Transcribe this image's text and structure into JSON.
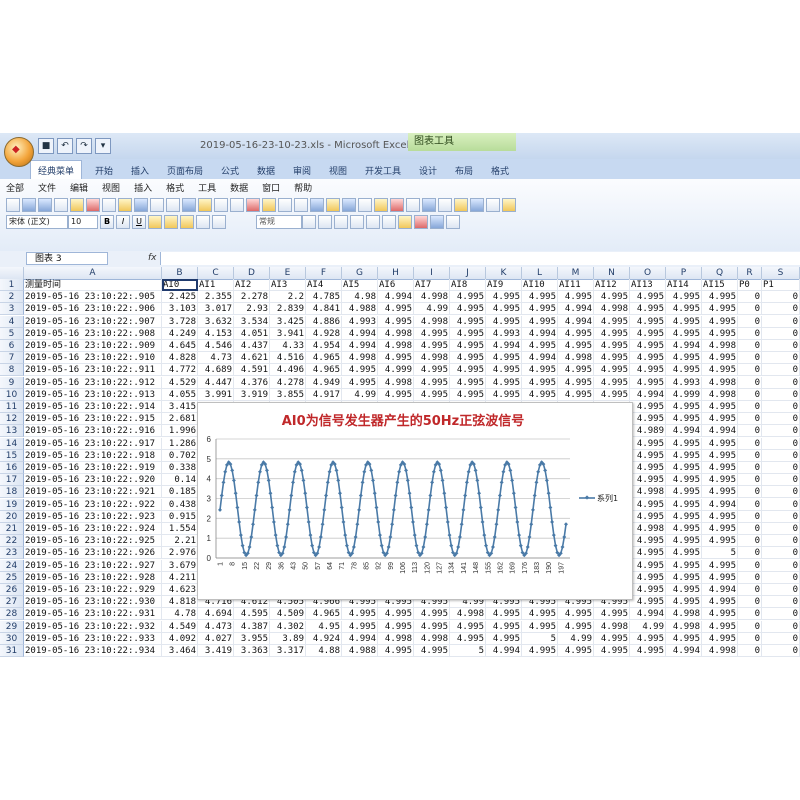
{
  "window": {
    "title": "2019-05-16-23-10-23.xls - Microsoft Excel",
    "context_tab": "图表工具"
  },
  "ribbon_tabs": [
    "经典菜单",
    "开始",
    "插入",
    "页面布局",
    "公式",
    "数据",
    "审阅",
    "视图",
    "开发工具",
    "设计",
    "布局",
    "格式"
  ],
  "menu": [
    "全部",
    "文件",
    "编辑",
    "视图",
    "插入",
    "格式",
    "工具",
    "数据",
    "窗口",
    "帮助"
  ],
  "toolbar": {
    "font": "宋体 (正文)",
    "size": "10",
    "number_format": "常规",
    "bold": "B",
    "italic": "I",
    "underline": "U"
  },
  "formula_bar": {
    "name_box": "图表 3",
    "fx": "fx",
    "content": ""
  },
  "columns": [
    "A",
    "B",
    "C",
    "D",
    "E",
    "F",
    "G",
    "H",
    "I",
    "J",
    "K",
    "L",
    "M",
    "N",
    "O",
    "P",
    "Q",
    "R",
    "S"
  ],
  "header_row": [
    "测量时间",
    "AI0",
    "AI1",
    "AI2",
    "AI3",
    "AI4",
    "AI5",
    "AI6",
    "AI7",
    "AI8",
    "AI9",
    "AI10",
    "AI11",
    "AI12",
    "AI13",
    "AI14",
    "AI15",
    "P0",
    "P1"
  ],
  "rows": [
    [
      "2019-05-16 23:10:22:.905",
      "2.425",
      "2.355",
      "2.278",
      "2.2",
      "4.785",
      "4.98",
      "4.994",
      "4.998",
      "4.995",
      "4.995",
      "4.995",
      "4.995",
      "4.995",
      "4.995",
      "4.995",
      "4.995",
      "0",
      "0"
    ],
    [
      "2019-05-16 23:10:22:.906",
      "3.103",
      "3.017",
      "2.93",
      "2.839",
      "4.841",
      "4.988",
      "4.995",
      "4.99",
      "4.995",
      "4.995",
      "4.995",
      "4.994",
      "4.998",
      "4.995",
      "4.995",
      "4.995",
      "0",
      "0"
    ],
    [
      "2019-05-16 23:10:22:.907",
      "3.728",
      "3.632",
      "3.534",
      "3.425",
      "4.886",
      "4.993",
      "4.995",
      "4.998",
      "4.995",
      "4.995",
      "4.995",
      "4.994",
      "4.995",
      "4.995",
      "4.995",
      "4.995",
      "0",
      "0"
    ],
    [
      "2019-05-16 23:10:22:.908",
      "4.249",
      "4.153",
      "4.051",
      "3.941",
      "4.928",
      "4.994",
      "4.998",
      "4.995",
      "4.995",
      "4.993",
      "4.994",
      "4.995",
      "4.995",
      "4.995",
      "4.995",
      "4.995",
      "0",
      "0"
    ],
    [
      "2019-05-16 23:10:22:.909",
      "4.645",
      "4.546",
      "4.437",
      "4.33",
      "4.954",
      "4.994",
      "4.998",
      "4.995",
      "4.995",
      "4.994",
      "4.995",
      "4.995",
      "4.995",
      "4.995",
      "4.994",
      "4.998",
      "0",
      "0"
    ],
    [
      "2019-05-16 23:10:22:.910",
      "4.828",
      "4.73",
      "4.621",
      "4.516",
      "4.965",
      "4.998",
      "4.995",
      "4.998",
      "4.995",
      "4.995",
      "4.994",
      "4.998",
      "4.995",
      "4.995",
      "4.995",
      "4.995",
      "0",
      "0"
    ],
    [
      "2019-05-16 23:10:22:.911",
      "4.772",
      "4.689",
      "4.591",
      "4.496",
      "4.965",
      "4.995",
      "4.999",
      "4.995",
      "4.995",
      "4.995",
      "4.995",
      "4.995",
      "4.995",
      "4.995",
      "4.995",
      "4.995",
      "0",
      "0"
    ],
    [
      "2019-05-16 23:10:22:.912",
      "4.529",
      "4.447",
      "4.376",
      "4.278",
      "4.949",
      "4.995",
      "4.998",
      "4.995",
      "4.995",
      "4.995",
      "4.995",
      "4.995",
      "4.995",
      "4.995",
      "4.993",
      "4.998",
      "0",
      "0"
    ],
    [
      "2019-05-16 23:10:22:.913",
      "4.055",
      "3.991",
      "3.919",
      "3.855",
      "4.917",
      "4.99",
      "4.995",
      "4.995",
      "4.995",
      "4.995",
      "4.995",
      "4.995",
      "4.995",
      "4.994",
      "4.999",
      "4.998",
      "0",
      "0"
    ],
    [
      "2019-05-16 23:10:22:.914",
      "3.415",
      "",
      "",
      "",
      "",
      "",
      "",
      "",
      "",
      "",
      "",
      "",
      "",
      "4.995",
      "4.995",
      "4.995",
      "0",
      "0"
    ],
    [
      "2019-05-16 23:10:22:.915",
      "2.681",
      "",
      "",
      "",
      "",
      "",
      "",
      "",
      "",
      "",
      "",
      "",
      "",
      "4.995",
      "4.995",
      "4.995",
      "0",
      "0"
    ],
    [
      "2019-05-16 23:10:22:.916",
      "1.996",
      "",
      "",
      "",
      "",
      "",
      "",
      "",
      "",
      "",
      "",
      "",
      "",
      "4.989",
      "4.994",
      "4.994",
      "0",
      "0"
    ],
    [
      "2019-05-16 23:10:22:.917",
      "1.286",
      "",
      "",
      "",
      "",
      "",
      "",
      "",
      "",
      "",
      "",
      "",
      "",
      "4.995",
      "4.995",
      "4.995",
      "0",
      "0"
    ],
    [
      "2019-05-16 23:10:22:.918",
      "0.702",
      "",
      "",
      "",
      "",
      "",
      "",
      "",
      "",
      "",
      "",
      "",
      "",
      "4.995",
      "4.995",
      "4.995",
      "0",
      "0"
    ],
    [
      "2019-05-16 23:10:22:.919",
      "0.338",
      "",
      "",
      "",
      "",
      "",
      "",
      "",
      "",
      "",
      "",
      "",
      "",
      "4.995",
      "4.995",
      "4.995",
      "0",
      "0"
    ],
    [
      "2019-05-16 23:10:22:.920",
      "0.14",
      "",
      "",
      "",
      "",
      "",
      "",
      "",
      "",
      "",
      "",
      "",
      "",
      "4.995",
      "4.995",
      "4.995",
      "0",
      "0"
    ],
    [
      "2019-05-16 23:10:22:.921",
      "0.185",
      "",
      "",
      "",
      "",
      "",
      "",
      "",
      "",
      "",
      "",
      "",
      "",
      "4.998",
      "4.995",
      "4.995",
      "0",
      "0"
    ],
    [
      "2019-05-16 23:10:22:.922",
      "0.438",
      "",
      "",
      "",
      "",
      "",
      "",
      "",
      "",
      "",
      "",
      "",
      "",
      "4.995",
      "4.995",
      "4.994",
      "0",
      "0"
    ],
    [
      "2019-05-16 23:10:22:.923",
      "0.915",
      "",
      "",
      "",
      "",
      "",
      "",
      "",
      "",
      "",
      "",
      "",
      "",
      "4.995",
      "4.995",
      "4.995",
      "0",
      "0"
    ],
    [
      "2019-05-16 23:10:22:.924",
      "1.554",
      "",
      "",
      "",
      "",
      "",
      "",
      "",
      "",
      "",
      "",
      "",
      "",
      "4.998",
      "4.995",
      "4.995",
      "0",
      "0"
    ],
    [
      "2019-05-16 23:10:22:.925",
      "2.21",
      "",
      "",
      "",
      "",
      "",
      "",
      "",
      "",
      "",
      "",
      "",
      "",
      "4.995",
      "4.995",
      "4.995",
      "0",
      "0"
    ],
    [
      "2019-05-16 23:10:22:.926",
      "2.976",
      "",
      "",
      "",
      "",
      "",
      "",
      "",
      "",
      "",
      "",
      "",
      "",
      "4.995",
      "4.995",
      "5",
      "0",
      "0"
    ],
    [
      "2019-05-16 23:10:22:.927",
      "3.679",
      "",
      "",
      "",
      "",
      "",
      "",
      "",
      "",
      "",
      "",
      "",
      "",
      "4.995",
      "4.995",
      "4.995",
      "0",
      "0"
    ],
    [
      "2019-05-16 23:10:22:.928",
      "4.211",
      "",
      "",
      "",
      "",
      "",
      "",
      "",
      "",
      "",
      "",
      "",
      "",
      "4.995",
      "4.995",
      "4.995",
      "0",
      "0"
    ],
    [
      "2019-05-16 23:10:22:.929",
      "4.623",
      "",
      "",
      "",
      "",
      "",
      "",
      "",
      "",
      "",
      "",
      "",
      "",
      "4.995",
      "4.995",
      "4.994",
      "0",
      "0"
    ],
    [
      "2019-05-16 23:10:22:.930",
      "4.818",
      "4.716",
      "4.612",
      "4.505",
      "4.966",
      "4.995",
      "4.995",
      "4.995",
      "4.99",
      "4.995",
      "4.995",
      "4.995",
      "4.995",
      "4.995",
      "4.995",
      "4.995",
      "0",
      "0"
    ],
    [
      "2019-05-16 23:10:22:.931",
      "4.78",
      "4.694",
      "4.595",
      "4.509",
      "4.965",
      "4.995",
      "4.995",
      "4.995",
      "4.998",
      "4.995",
      "4.995",
      "4.995",
      "4.995",
      "4.994",
      "4.998",
      "4.995",
      "0",
      "0"
    ],
    [
      "2019-05-16 23:10:22:.932",
      "4.549",
      "4.473",
      "4.387",
      "4.302",
      "4.95",
      "4.995",
      "4.995",
      "4.995",
      "4.995",
      "4.995",
      "4.995",
      "4.995",
      "4.998",
      "4.99",
      "4.998",
      "4.995",
      "0",
      "0"
    ],
    [
      "2019-05-16 23:10:22:.933",
      "4.092",
      "4.027",
      "3.955",
      "3.89",
      "4.924",
      "4.994",
      "4.998",
      "4.998",
      "4.995",
      "4.995",
      "5",
      "4.99",
      "4.995",
      "4.995",
      "4.995",
      "4.995",
      "0",
      "0"
    ],
    [
      "2019-05-16 23:10:22:.934",
      "3.464",
      "3.419",
      "3.363",
      "3.317",
      "4.88",
      "4.988",
      "4.995",
      "4.995",
      "5",
      "4.994",
      "4.995",
      "4.995",
      "4.995",
      "4.995",
      "4.994",
      "4.998",
      "0",
      "0"
    ]
  ],
  "chart_data": {
    "type": "line",
    "title": "AI0为信号发生器产生的50Hz正弦波信号",
    "series": [
      {
        "name": "系列1",
        "color": "#4a7aa7"
      }
    ],
    "signal": {
      "cycles": 10,
      "points": 200,
      "min": 0.14,
      "max": 4.83,
      "start": 2.425
    },
    "ylim": [
      0,
      6
    ],
    "yticks": [
      "0",
      "1",
      "2",
      "3",
      "4",
      "5",
      "6"
    ],
    "xticks": [
      "1",
      "8",
      "15",
      "22",
      "29",
      "36",
      "43",
      "50",
      "57",
      "64",
      "71",
      "78",
      "85",
      "92",
      "99",
      "106",
      "113",
      "120",
      "127",
      "134",
      "141",
      "148",
      "155",
      "162",
      "169",
      "176",
      "183",
      "190",
      "197"
    ],
    "legend_position": "right",
    "grid": true
  }
}
